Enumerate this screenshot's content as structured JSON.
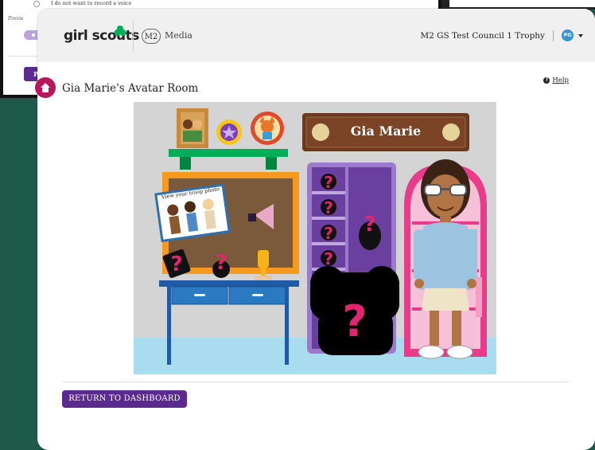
{
  "background_window": {
    "option_text": "I do not want to record a voice",
    "preview_label": "Previe",
    "button_label": "PI"
  },
  "header": {
    "logo_text": "girl scouts",
    "m2_badge": "M2",
    "media_label": "Media",
    "account_name": "M2 GS Test Council 1 Trophy",
    "avatar_initials": "PG"
  },
  "page": {
    "title": "Gia Marie's Avatar Room",
    "help_label": "Help",
    "help_icon_glyph": "?"
  },
  "scene": {
    "name_sign": "Gia Marie",
    "troop_photo_caption": "View your troop photo",
    "mystery_glyph": "?"
  },
  "footer": {
    "return_button": "RETURN TO DASHBOARD"
  },
  "colors": {
    "brand_purple": "#5b2a8e",
    "home_magenta": "#b8155a",
    "gs_green": "#00ae58",
    "wall": "#d4d4d4",
    "floor": "#a9dcee"
  }
}
